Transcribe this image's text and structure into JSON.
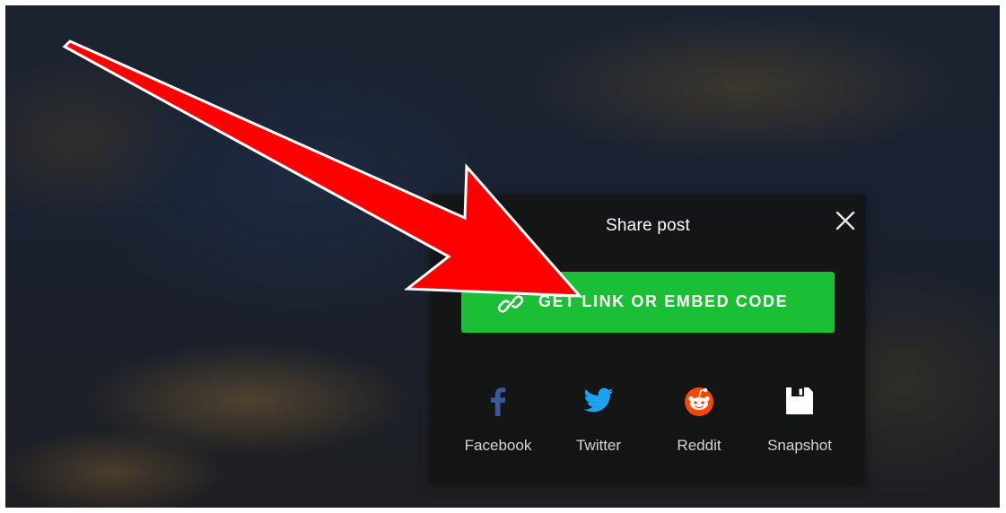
{
  "dialog": {
    "title": "Share post",
    "embed_button_label": "GET LINK OR EMBED CODE",
    "share_options": [
      {
        "label": "Facebook",
        "icon": "facebook-icon",
        "color": "#3b5998"
      },
      {
        "label": "Twitter",
        "icon": "twitter-icon",
        "color": "#1da1f2"
      },
      {
        "label": "Reddit",
        "icon": "reddit-icon",
        "color": "#ff4500"
      },
      {
        "label": "Snapshot",
        "icon": "save-icon",
        "color": "#ffffff"
      }
    ]
  },
  "colors": {
    "accent_green": "#1bbf35",
    "annotation_arrow": "#ff0000",
    "dialog_background": "#141414"
  }
}
